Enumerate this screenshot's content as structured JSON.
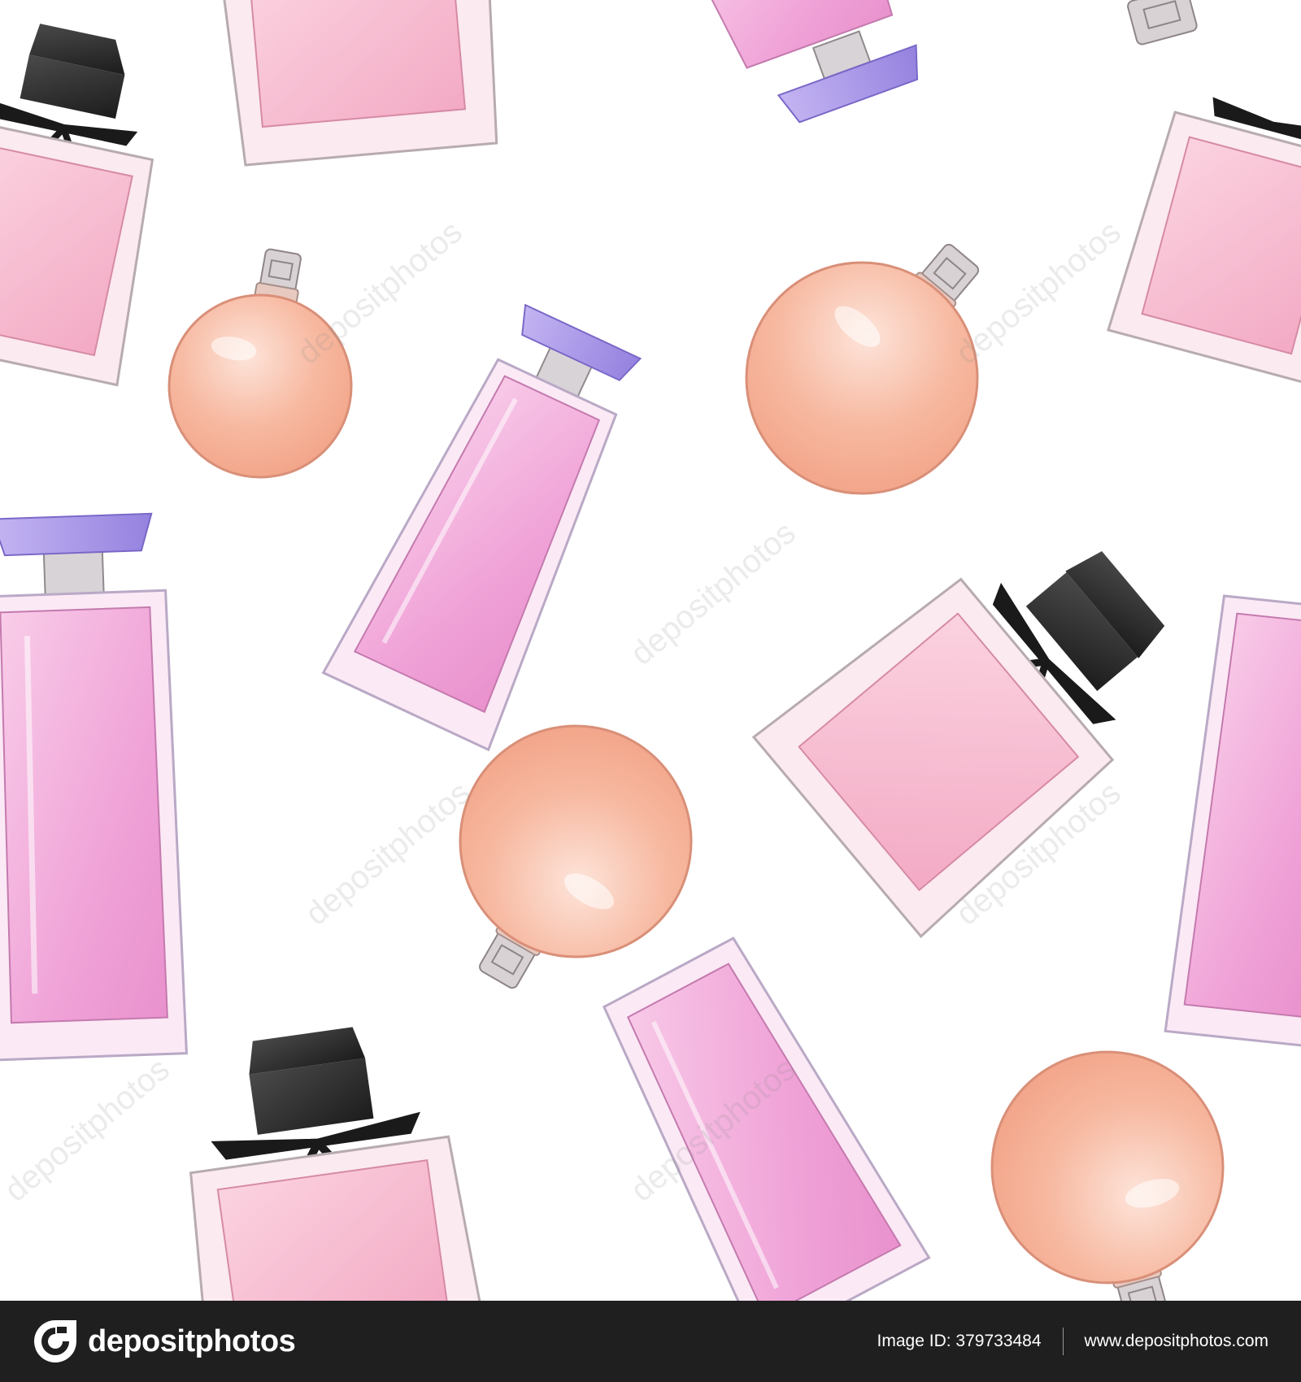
{
  "watermark": {
    "text": "depositphotos"
  },
  "footer": {
    "brand": "depositphotos",
    "logo_icon": "depositphotos-logo-icon",
    "image_id_label": "Image ID:",
    "image_id_value": "379733484",
    "website": "www.depositphotos.com"
  },
  "colors": {
    "background": "#ffffff",
    "footer_background": "#1f1f1f",
    "pink_glass": "#f3a9dc",
    "peach_glass": "#f7b9a1",
    "violet_cap": "#a996e8",
    "black_cap": "#2b2b2b",
    "silver_neck": "#c9c4c6"
  }
}
